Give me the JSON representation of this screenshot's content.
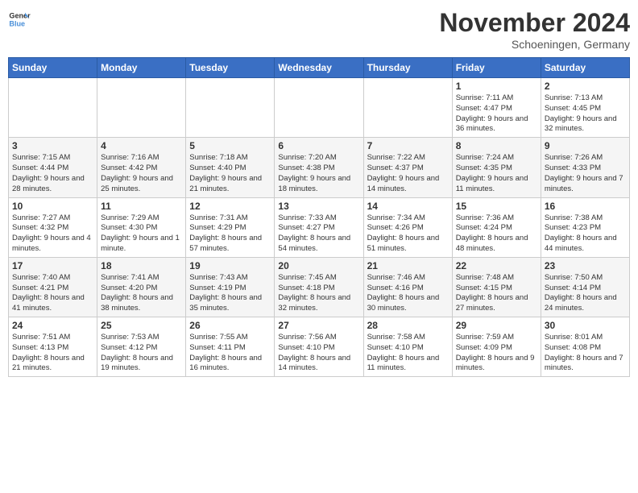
{
  "header": {
    "logo_line1": "General",
    "logo_line2": "Blue",
    "month": "November 2024",
    "location": "Schoeningen, Germany"
  },
  "weekdays": [
    "Sunday",
    "Monday",
    "Tuesday",
    "Wednesday",
    "Thursday",
    "Friday",
    "Saturday"
  ],
  "weeks": [
    [
      {
        "day": "",
        "info": ""
      },
      {
        "day": "",
        "info": ""
      },
      {
        "day": "",
        "info": ""
      },
      {
        "day": "",
        "info": ""
      },
      {
        "day": "",
        "info": ""
      },
      {
        "day": "1",
        "info": "Sunrise: 7:11 AM\nSunset: 4:47 PM\nDaylight: 9 hours and 36 minutes."
      },
      {
        "day": "2",
        "info": "Sunrise: 7:13 AM\nSunset: 4:45 PM\nDaylight: 9 hours and 32 minutes."
      }
    ],
    [
      {
        "day": "3",
        "info": "Sunrise: 7:15 AM\nSunset: 4:44 PM\nDaylight: 9 hours and 28 minutes."
      },
      {
        "day": "4",
        "info": "Sunrise: 7:16 AM\nSunset: 4:42 PM\nDaylight: 9 hours and 25 minutes."
      },
      {
        "day": "5",
        "info": "Sunrise: 7:18 AM\nSunset: 4:40 PM\nDaylight: 9 hours and 21 minutes."
      },
      {
        "day": "6",
        "info": "Sunrise: 7:20 AM\nSunset: 4:38 PM\nDaylight: 9 hours and 18 minutes."
      },
      {
        "day": "7",
        "info": "Sunrise: 7:22 AM\nSunset: 4:37 PM\nDaylight: 9 hours and 14 minutes."
      },
      {
        "day": "8",
        "info": "Sunrise: 7:24 AM\nSunset: 4:35 PM\nDaylight: 9 hours and 11 minutes."
      },
      {
        "day": "9",
        "info": "Sunrise: 7:26 AM\nSunset: 4:33 PM\nDaylight: 9 hours and 7 minutes."
      }
    ],
    [
      {
        "day": "10",
        "info": "Sunrise: 7:27 AM\nSunset: 4:32 PM\nDaylight: 9 hours and 4 minutes."
      },
      {
        "day": "11",
        "info": "Sunrise: 7:29 AM\nSunset: 4:30 PM\nDaylight: 9 hours and 1 minute."
      },
      {
        "day": "12",
        "info": "Sunrise: 7:31 AM\nSunset: 4:29 PM\nDaylight: 8 hours and 57 minutes."
      },
      {
        "day": "13",
        "info": "Sunrise: 7:33 AM\nSunset: 4:27 PM\nDaylight: 8 hours and 54 minutes."
      },
      {
        "day": "14",
        "info": "Sunrise: 7:34 AM\nSunset: 4:26 PM\nDaylight: 8 hours and 51 minutes."
      },
      {
        "day": "15",
        "info": "Sunrise: 7:36 AM\nSunset: 4:24 PM\nDaylight: 8 hours and 48 minutes."
      },
      {
        "day": "16",
        "info": "Sunrise: 7:38 AM\nSunset: 4:23 PM\nDaylight: 8 hours and 44 minutes."
      }
    ],
    [
      {
        "day": "17",
        "info": "Sunrise: 7:40 AM\nSunset: 4:21 PM\nDaylight: 8 hours and 41 minutes."
      },
      {
        "day": "18",
        "info": "Sunrise: 7:41 AM\nSunset: 4:20 PM\nDaylight: 8 hours and 38 minutes."
      },
      {
        "day": "19",
        "info": "Sunrise: 7:43 AM\nSunset: 4:19 PM\nDaylight: 8 hours and 35 minutes."
      },
      {
        "day": "20",
        "info": "Sunrise: 7:45 AM\nSunset: 4:18 PM\nDaylight: 8 hours and 32 minutes."
      },
      {
        "day": "21",
        "info": "Sunrise: 7:46 AM\nSunset: 4:16 PM\nDaylight: 8 hours and 30 minutes."
      },
      {
        "day": "22",
        "info": "Sunrise: 7:48 AM\nSunset: 4:15 PM\nDaylight: 8 hours and 27 minutes."
      },
      {
        "day": "23",
        "info": "Sunrise: 7:50 AM\nSunset: 4:14 PM\nDaylight: 8 hours and 24 minutes."
      }
    ],
    [
      {
        "day": "24",
        "info": "Sunrise: 7:51 AM\nSunset: 4:13 PM\nDaylight: 8 hours and 21 minutes."
      },
      {
        "day": "25",
        "info": "Sunrise: 7:53 AM\nSunset: 4:12 PM\nDaylight: 8 hours and 19 minutes."
      },
      {
        "day": "26",
        "info": "Sunrise: 7:55 AM\nSunset: 4:11 PM\nDaylight: 8 hours and 16 minutes."
      },
      {
        "day": "27",
        "info": "Sunrise: 7:56 AM\nSunset: 4:10 PM\nDaylight: 8 hours and 14 minutes."
      },
      {
        "day": "28",
        "info": "Sunrise: 7:58 AM\nSunset: 4:10 PM\nDaylight: 8 hours and 11 minutes."
      },
      {
        "day": "29",
        "info": "Sunrise: 7:59 AM\nSunset: 4:09 PM\nDaylight: 8 hours and 9 minutes."
      },
      {
        "day": "30",
        "info": "Sunrise: 8:01 AM\nSunset: 4:08 PM\nDaylight: 8 hours and 7 minutes."
      }
    ]
  ]
}
